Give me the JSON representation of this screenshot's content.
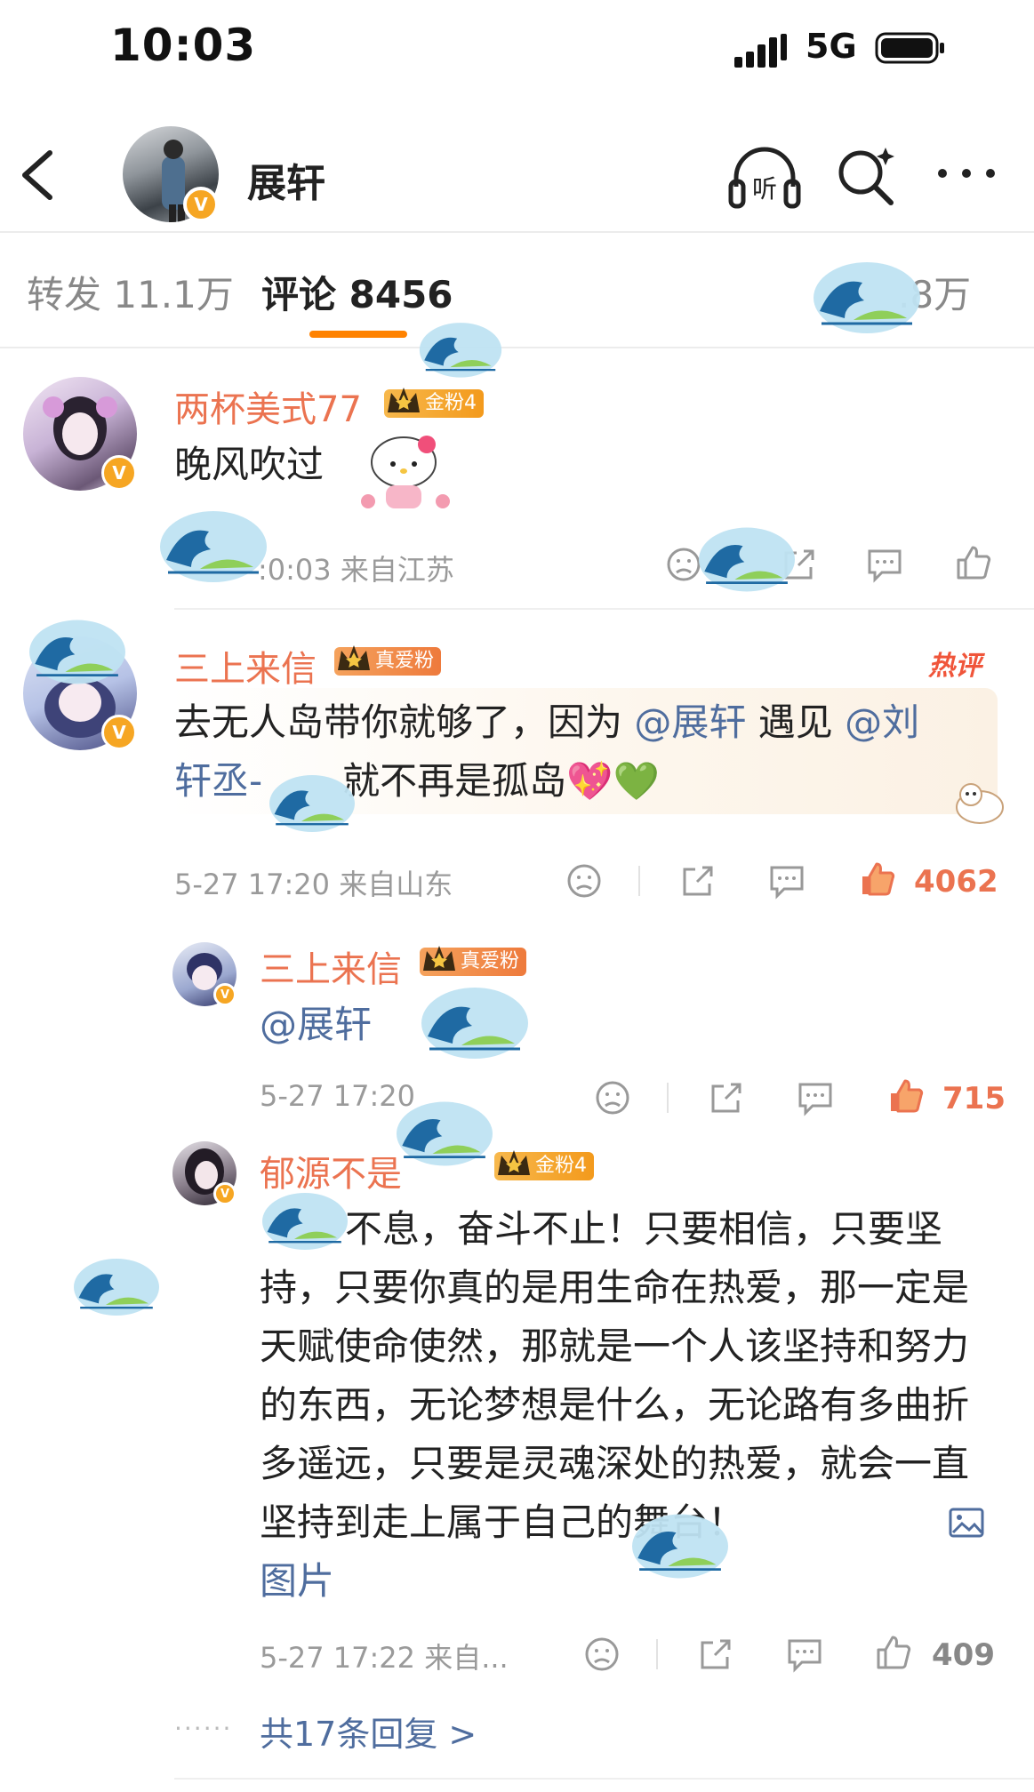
{
  "status_bar": {
    "time": "10:03",
    "network": "5G"
  },
  "header": {
    "title": "展轩"
  },
  "tabs": [
    {
      "label": "转发 11.1万"
    },
    {
      "label": "评论 8456"
    },
    {
      "label": ".8万"
    }
  ],
  "comments": [
    {
      "username": "两杯美式77",
      "fan_badge": "金粉4",
      "text": "晚风吹过",
      "meta": ":0:03 来自江苏"
    },
    {
      "username": "三上来信",
      "fan_badge": "真爱粉",
      "hot_label": "热评",
      "text_parts": [
        "去无人岛带你就够了，因为 ",
        "@展轩",
        " 遇见 ",
        "@刘",
        "轩丞-",
        "就不再是孤岛💖💚"
      ],
      "meta": "5-27 17:20 来自山东",
      "likes": "4062",
      "replies": [
        {
          "username": "三上来信",
          "fan_badge": "真爱粉",
          "text": "@展轩",
          "meta": "5-27 17:20",
          "likes": "715"
        },
        {
          "username": "郁源不是",
          "fan_badge": "金粉4",
          "text": "不息，奋斗不止！只要相信，只要坚持，只要你真的是用生命在热爱，那一定是天赋使命使然，那就是一个人该坚持和努力的东西，无论梦想是什么，无论路有多曲折多遥远，只要是灵魂深处的热爱，就会一直坚持到走上属于自己的舞台！",
          "image_link": "图片",
          "meta": "5-27 17:22 来自...",
          "likes": "409"
        }
      ],
      "replies_link": "共17条回复 >"
    }
  ]
}
